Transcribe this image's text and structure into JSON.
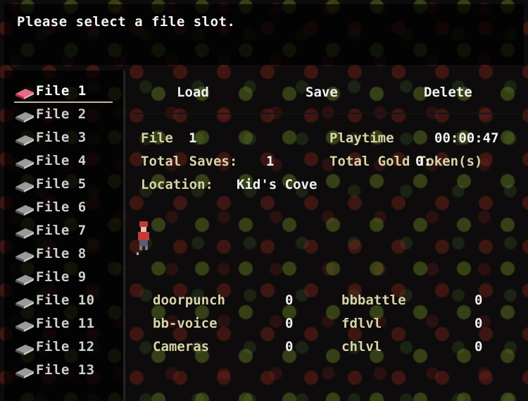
{
  "prompt": "Please select a file slot.",
  "files": [
    "File 1",
    "File 2",
    "File 3",
    "File 4",
    "File 5",
    "File 6",
    "File 7",
    "File 8",
    "File 9",
    "File 10",
    "File 11",
    "File 12",
    "File 13"
  ],
  "selected_file": "File 1",
  "actions": {
    "load": "Load",
    "save": "Save",
    "delete": "Delete"
  },
  "details": {
    "file_label": "File",
    "file_number": "1",
    "playtime_label": "Playtime",
    "playtime_value": "00:00:47",
    "total_saves_label": "Total Saves:",
    "total_saves_value": "1",
    "total_gold_label": "Total Gold Token(s)",
    "total_gold_value": "0:",
    "location_label": "Location:",
    "location_value": "Kid's Cove"
  },
  "stats_left": [
    {
      "name": "doorpunch",
      "value": "0"
    },
    {
      "name": "bb-voice",
      "value": "0"
    },
    {
      "name": "Cameras",
      "value": "0"
    }
  ],
  "stats_right": [
    {
      "name": "bbbattle",
      "value": "0"
    },
    {
      "name": "fdlvl",
      "value": "0"
    },
    {
      "name": "chlvl",
      "value": "0"
    }
  ],
  "colors": {
    "selected_book": "#e0506e",
    "book": "#8c8c8c",
    "label": "#d8d3a8",
    "text": "#f2f2f2"
  }
}
